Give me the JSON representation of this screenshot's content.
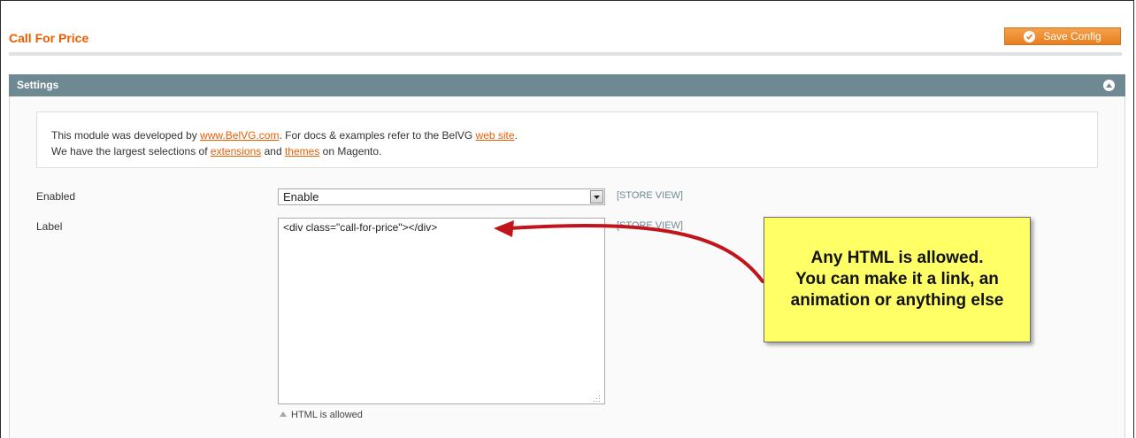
{
  "header": {
    "title": "Call For Price",
    "save_button": {
      "label": "Save Config",
      "icon": "check-circle-icon"
    }
  },
  "section": {
    "title": "Settings",
    "collapse_icon": "collapse-up-icon",
    "comment": {
      "line1_prefix": "This module was developed by ",
      "line1_link1": "www.BelVG.com",
      "line1_middle": ". For docs & examples refer to the BelVG ",
      "line1_link2": "web site",
      "line1_suffix": ".",
      "line2_prefix": "We have the largest selections of ",
      "line2_link1": "extensions",
      "line2_middle": " and ",
      "line2_link2": "themes",
      "line2_suffix": " on Magento."
    },
    "fields": {
      "enabled": {
        "label": "Enabled",
        "value": "Enable",
        "scope": "[STORE VIEW]"
      },
      "label": {
        "label": "Label",
        "value": "<div class=\"call-for-price\"></div>",
        "scope": "[STORE VIEW]",
        "note": "HTML is allowed"
      }
    }
  },
  "annotation": {
    "text": "Any HTML is allowed.\nYou can make it a link, an animation or anything else",
    "arrow_color": "#c0161b"
  },
  "colors": {
    "accent": "#eb5e00",
    "section_header": "#6f8992",
    "callout_bg": "#ffff66"
  }
}
